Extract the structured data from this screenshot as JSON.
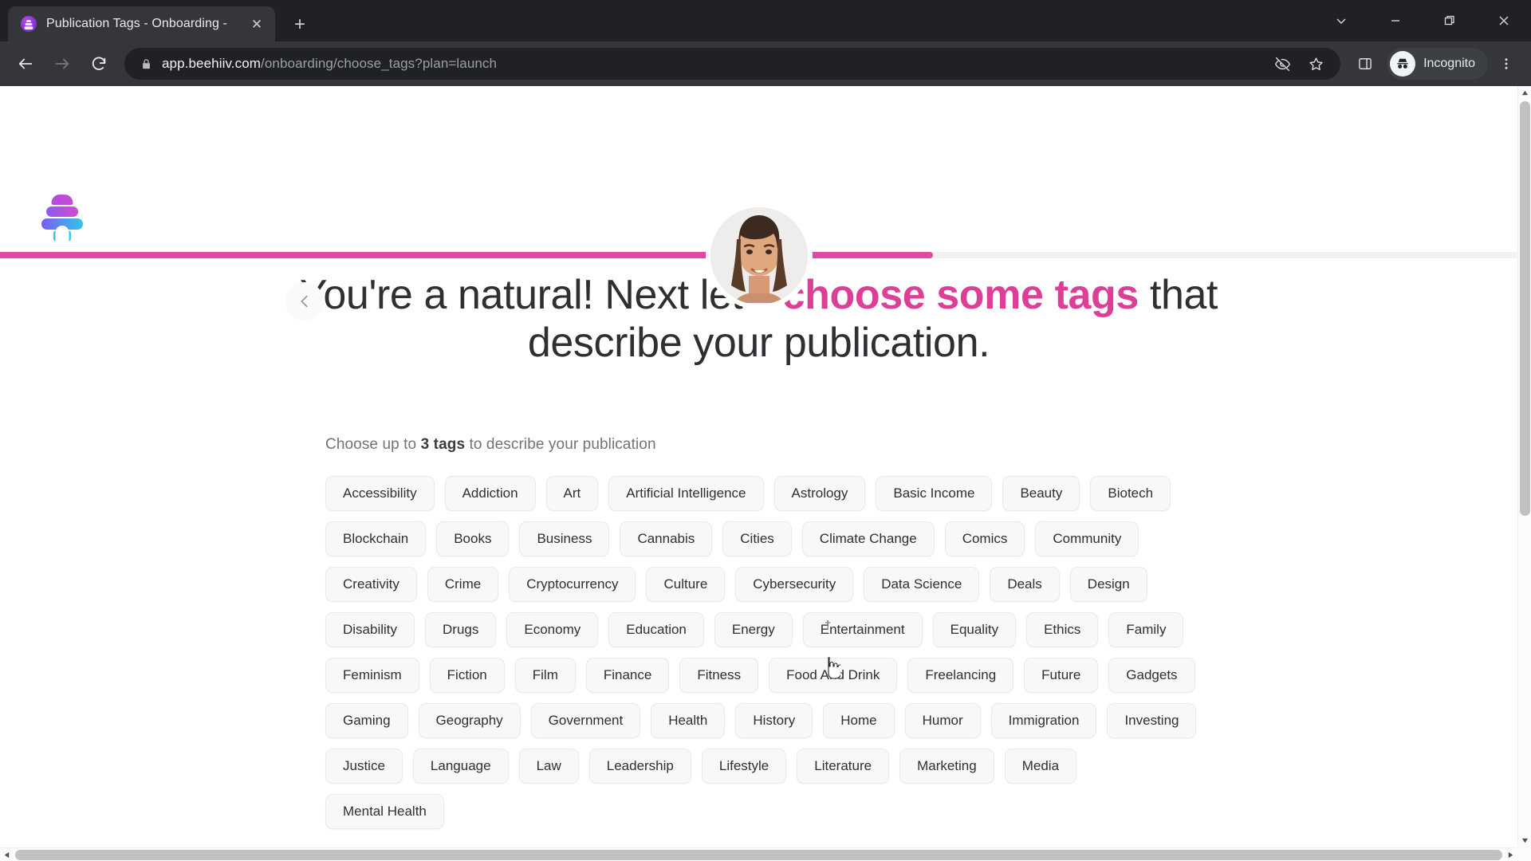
{
  "browser": {
    "tab": {
      "title": "Publication Tags - Onboarding -",
      "favicon_name": "beehiiv-favicon",
      "close_label": "✕"
    },
    "new_tab_label": "+",
    "window_controls": [
      {
        "name": "tab-search-button",
        "label": "⌄"
      },
      {
        "name": "minimize-button",
        "label": "—"
      },
      {
        "name": "maximize-button",
        "label": "❐"
      },
      {
        "name": "close-window-button",
        "label": "✕"
      }
    ],
    "nav": {
      "back_label": "←",
      "forward_label": "→",
      "reload_label": "↻"
    },
    "omnibox": {
      "lock_icon": "lock-icon",
      "host": "app.beehiiv.com",
      "path": "/onboarding/choose_tags?plan=launch",
      "full_url": "app.beehiiv.com/onboarding/choose_tags?plan=launch",
      "third_party_cookie_icon": "eye-slash-icon",
      "bookmark_icon": "star-icon"
    },
    "side_panel_icon": "side-panel-icon",
    "profile": {
      "label": "Incognito",
      "icon": "incognito-icon"
    },
    "menu_icon": "three-dot-menu-icon"
  },
  "page": {
    "logo_name": "beehiiv-logo",
    "avatar_name": "onboarding-avatar",
    "progress": {
      "percent": 61.5,
      "fill_color": "#e247a3",
      "track_color": "#f2f2f3"
    },
    "back_button_icon": "chevron-left-icon",
    "heading": {
      "part1": "You're a natural! Next let's ",
      "accent": "choose some tags",
      "part2": " that describe your publication."
    },
    "subtitle": {
      "prefix": "Choose up to ",
      "count": "3 tags",
      "suffix": " to describe your publication"
    },
    "tags": [
      "Accessibility",
      "Addiction",
      "Art",
      "Artificial Intelligence",
      "Astrology",
      "Basic Income",
      "Beauty",
      "Biotech",
      "Blockchain",
      "Books",
      "Business",
      "Cannabis",
      "Cities",
      "Climate Change",
      "Comics",
      "Community",
      "Creativity",
      "Crime",
      "Cryptocurrency",
      "Culture",
      "Cybersecurity",
      "Data Science",
      "Deals",
      "Design",
      "Disability",
      "Drugs",
      "Economy",
      "Education",
      "Energy",
      "Entertainment",
      "Equality",
      "Ethics",
      "Family",
      "Feminism",
      "Fiction",
      "Film",
      "Finance",
      "Fitness",
      "Food And Drink",
      "Freelancing",
      "Future",
      "Gadgets",
      "Gaming",
      "Geography",
      "Government",
      "Health",
      "History",
      "Home",
      "Humor",
      "Immigration",
      "Investing",
      "Justice",
      "Language",
      "Law",
      "Leadership",
      "Lifestyle",
      "Literature",
      "Marketing",
      "Media",
      "Mental Health"
    ],
    "accent_color": "#dd3f96"
  },
  "scrollbars": {
    "vertical": {
      "up_label": "▲",
      "down_label": "▼"
    },
    "horizontal": {
      "left_label": "◀",
      "right_label": "▶"
    }
  }
}
